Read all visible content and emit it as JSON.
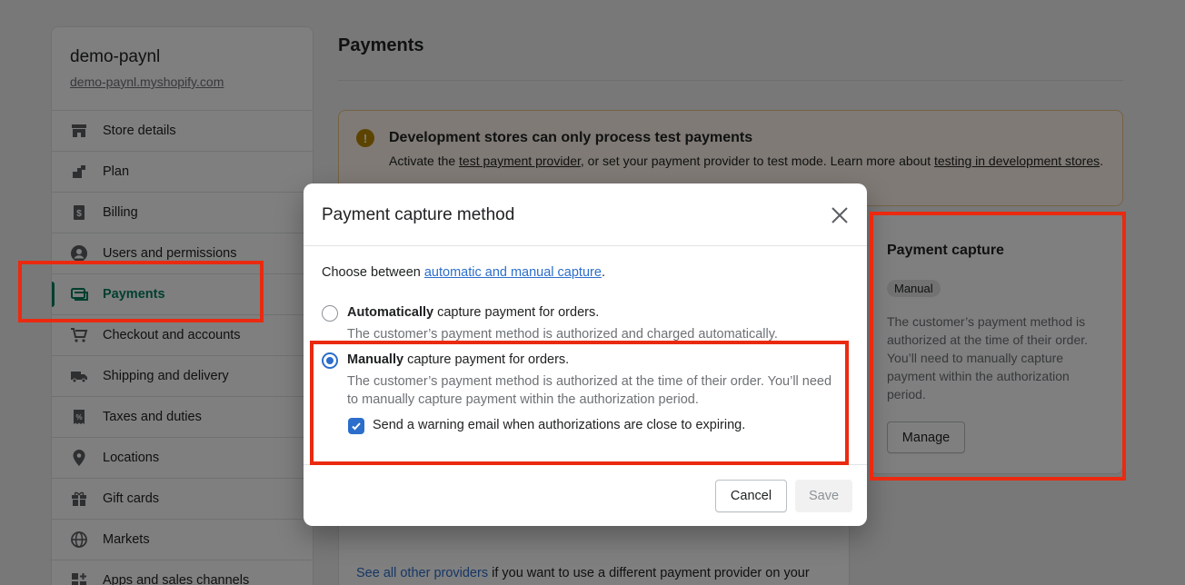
{
  "sidebar": {
    "store_name": "demo-paynl",
    "store_url": "demo-paynl.myshopify.com",
    "items": [
      {
        "label": "Store details",
        "icon": "store-icon"
      },
      {
        "label": "Plan",
        "icon": "plan-icon"
      },
      {
        "label": "Billing",
        "icon": "billing-icon"
      },
      {
        "label": "Users and permissions",
        "icon": "user-icon"
      },
      {
        "label": "Payments",
        "icon": "payments-icon",
        "active": true
      },
      {
        "label": "Checkout and accounts",
        "icon": "cart-icon"
      },
      {
        "label": "Shipping and delivery",
        "icon": "truck-icon"
      },
      {
        "label": "Taxes and duties",
        "icon": "tax-icon"
      },
      {
        "label": "Locations",
        "icon": "location-pin-icon"
      },
      {
        "label": "Gift cards",
        "icon": "gift-icon"
      },
      {
        "label": "Markets",
        "icon": "globe-icon"
      },
      {
        "label": "Apps and sales channels",
        "icon": "apps-icon"
      }
    ]
  },
  "page": {
    "title": "Payments"
  },
  "banner": {
    "title": "Development stores can only process test payments",
    "text_1": "Activate the ",
    "link_1": "test payment provider",
    "text_2": ", or set your payment provider to test mode. Learn more about ",
    "link_2": "testing in development stores",
    "text_3": "."
  },
  "payment_capture_card": {
    "title": "Payment capture",
    "badge": "Manual",
    "description": "The customer’s payment method is authorized at the time of their order. You’ll need to manually capture payment within the authorization period.",
    "manage_label": "Manage"
  },
  "providers_footer": {
    "link": "See all other providers",
    "text": " if you want to use a different payment provider on your"
  },
  "modal": {
    "title": "Payment capture method",
    "intro_text": "Choose between ",
    "intro_link": "automatic and manual capture",
    "intro_end": ".",
    "options": [
      {
        "label_bold": "Automatically",
        "label_rest": " capture payment for orders.",
        "help": "The customer’s payment method is authorized and charged automatically.",
        "selected": false
      },
      {
        "label_bold": "Manually",
        "label_rest": " capture payment for orders.",
        "help": "The customer’s payment method is authorized at the time of their order. You’ll need to manually capture payment within the authorization period.",
        "selected": true
      }
    ],
    "warning_checkbox": {
      "label": "Send a warning email when authorizations are close to expiring.",
      "checked": true
    },
    "cancel_label": "Cancel",
    "save_label": "Save"
  },
  "colors": {
    "accent_green": "#007f5f",
    "link_blue": "#2c6ecb",
    "highlight_red": "#ea2a10",
    "warning_bg": "#fff5ea"
  }
}
